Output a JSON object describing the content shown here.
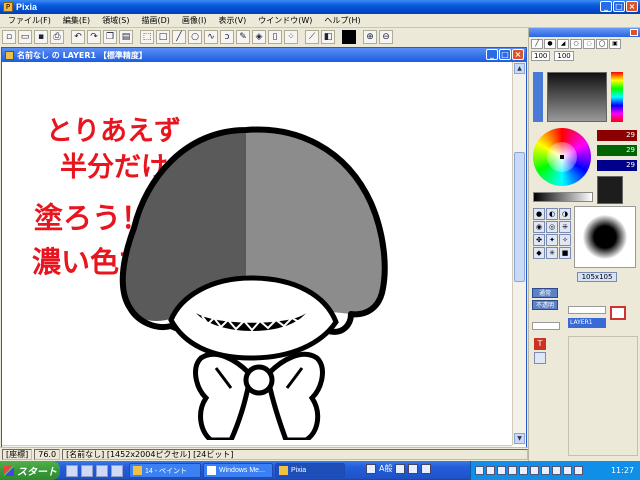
{
  "window": {
    "title": "Pixia"
  },
  "menu": [
    "ファイル(F)",
    "編集(E)",
    "領域(S)",
    "描画(D)",
    "画像(I)",
    "表示(V)",
    "ウインドウ(W)",
    "ヘルプ(H)"
  ],
  "document": {
    "title": "名前なし の LAYER1 【標準精度】",
    "handwritten_note": [
      "とりあえず",
      "半分だけ",
      "塗ろう！",
      "濃い色で。"
    ]
  },
  "status": {
    "label": "[座標]",
    "zoom": "76.0",
    "info": "[名前なし] [1452x2004ピクセル] [24ビット]"
  },
  "colors": {
    "r_value": "29",
    "g_value": "29",
    "b_value": "29",
    "brush_color": "#1d1d1d",
    "hair_dark": "#5a5a5a",
    "hair_light": "#8c8c8c"
  },
  "brush": {
    "size1": "100",
    "size2": "100",
    "preview_size": "105x105"
  },
  "layers": {
    "name": "LAYER1",
    "btn1": "通常",
    "btn2": "不透明"
  },
  "taskbar": {
    "start": "スタート",
    "tasks": [
      "14 - ペイント",
      "Windows Me...",
      "Pixia"
    ],
    "lang": "A般",
    "clock": "11:27"
  }
}
